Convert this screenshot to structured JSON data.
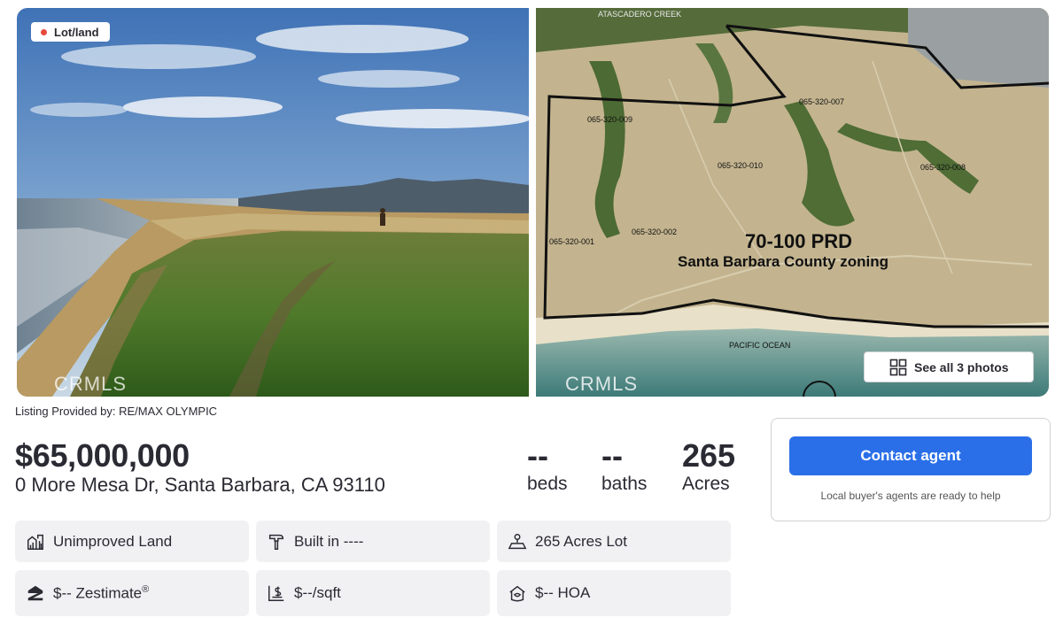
{
  "photos": {
    "badge_label": "Lot/land",
    "watermark_left": "CRMLS",
    "watermark_right": "CRMLS",
    "map": {
      "zoning_line1": "70-100 PRD",
      "zoning_line2": "Santa Barbara County zoning",
      "parcels": [
        "065-320-009",
        "065-320-007",
        "065-320-010",
        "065-320-008",
        "065-320-001",
        "065-320-002"
      ],
      "ocean_label": "PACIFIC OCEAN",
      "creek_label": "ATASCADERO CREEK"
    },
    "see_all_label": "See all 3 photos"
  },
  "listing": {
    "provided_by": "Listing Provided by: RE/MAX OLYMPIC",
    "price": "$65,000,000",
    "address": "0 More Mesa Dr, Santa Barbara, CA 93110",
    "beds_value": "--",
    "beds_label": "beds",
    "baths_value": "--",
    "baths_label": "baths",
    "acres_value": "265",
    "acres_label": "Acres"
  },
  "contact": {
    "button_label": "Contact agent",
    "note": "Local buyer's agents are ready to help"
  },
  "facts": {
    "type": "Unimproved Land",
    "built": "Built in ----",
    "lot": "265 Acres Lot",
    "zestimate": "$-- Zestimate",
    "zestimate_mark": "®",
    "price_sqft": "$--/sqft",
    "hoa": "$-- HOA"
  },
  "icons": {
    "badge_dot": "status-dot-icon",
    "see_all": "grid-icon",
    "type": "building-chart-icon",
    "built": "hammer-icon",
    "lot": "lot-size-icon",
    "zestimate": "zillow-logo-icon",
    "price_sqft": "price-per-sqft-icon",
    "hoa": "hoa-icon"
  },
  "colors": {
    "accent": "#2a6fe8",
    "badge_dot": "#e64a3b",
    "fact_bg": "#f1f1f4",
    "text": "#2a2a33"
  }
}
